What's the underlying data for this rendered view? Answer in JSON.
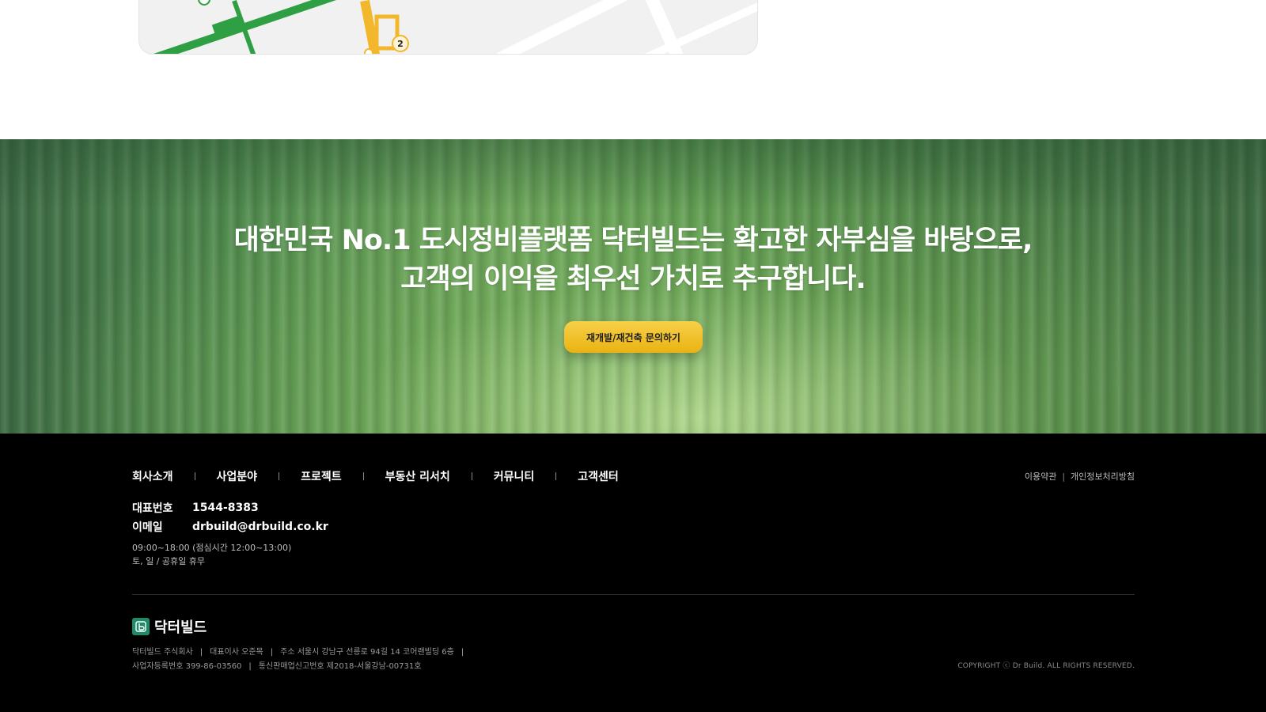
{
  "map": {
    "station_number": "2",
    "colors": {
      "green_line": "#2ea043",
      "yellow_line": "#f2b72a",
      "map_bg": "#f1f1f1"
    }
  },
  "banner": {
    "headline_line1": "대한민국 No.1 도시정비플랫폼 닥터빌드는 확고한 자부심을 바탕으로,",
    "headline_line2": "고객의 이익을 최우선 가치로 추구합니다.",
    "cta_label": "재개발/재건축 문의하기",
    "colors": {
      "cta": "#f2c12e"
    }
  },
  "footer": {
    "nav": [
      {
        "label": "회사소개"
      },
      {
        "label": "사업분야"
      },
      {
        "label": "프로젝트"
      },
      {
        "label": "부동산 리서치"
      },
      {
        "label": "커뮤니티"
      },
      {
        "label": "고객센터"
      }
    ],
    "legal": {
      "terms": "이용약관",
      "privacy": "개인정보처리방침",
      "separator": "|"
    },
    "contact": {
      "phone_label": "대표번호",
      "phone": "1544-8383",
      "email_label": "이메일",
      "email": "drbuild@drbuild.co.kr"
    },
    "hours": {
      "weekday": "09:00~18:00 (점심시간 12:00~13:00)",
      "closed": "토, 일 / 공휴일 휴무"
    },
    "brand": {
      "name": "닥터빌드",
      "logo_icon": "drbuild-logo-icon",
      "colors": {
        "logo": "#1f8a6a"
      }
    },
    "company_info": {
      "company": "닥터빌드 주식회사",
      "ceo": "대표이사 오준목",
      "address": "주소 서울시 강남구 선릉로 94길 14 코어랜빌딩 6층",
      "biz_no": "사업자등록번호 399-86-03560",
      "mail_order_no": "통신판매업신고번호 제2018-서울강남-00731호",
      "separator": "|"
    },
    "copyright": "COPYRIGHT ⓒ Dr Build. ALL RIGHTS RESERVED."
  }
}
